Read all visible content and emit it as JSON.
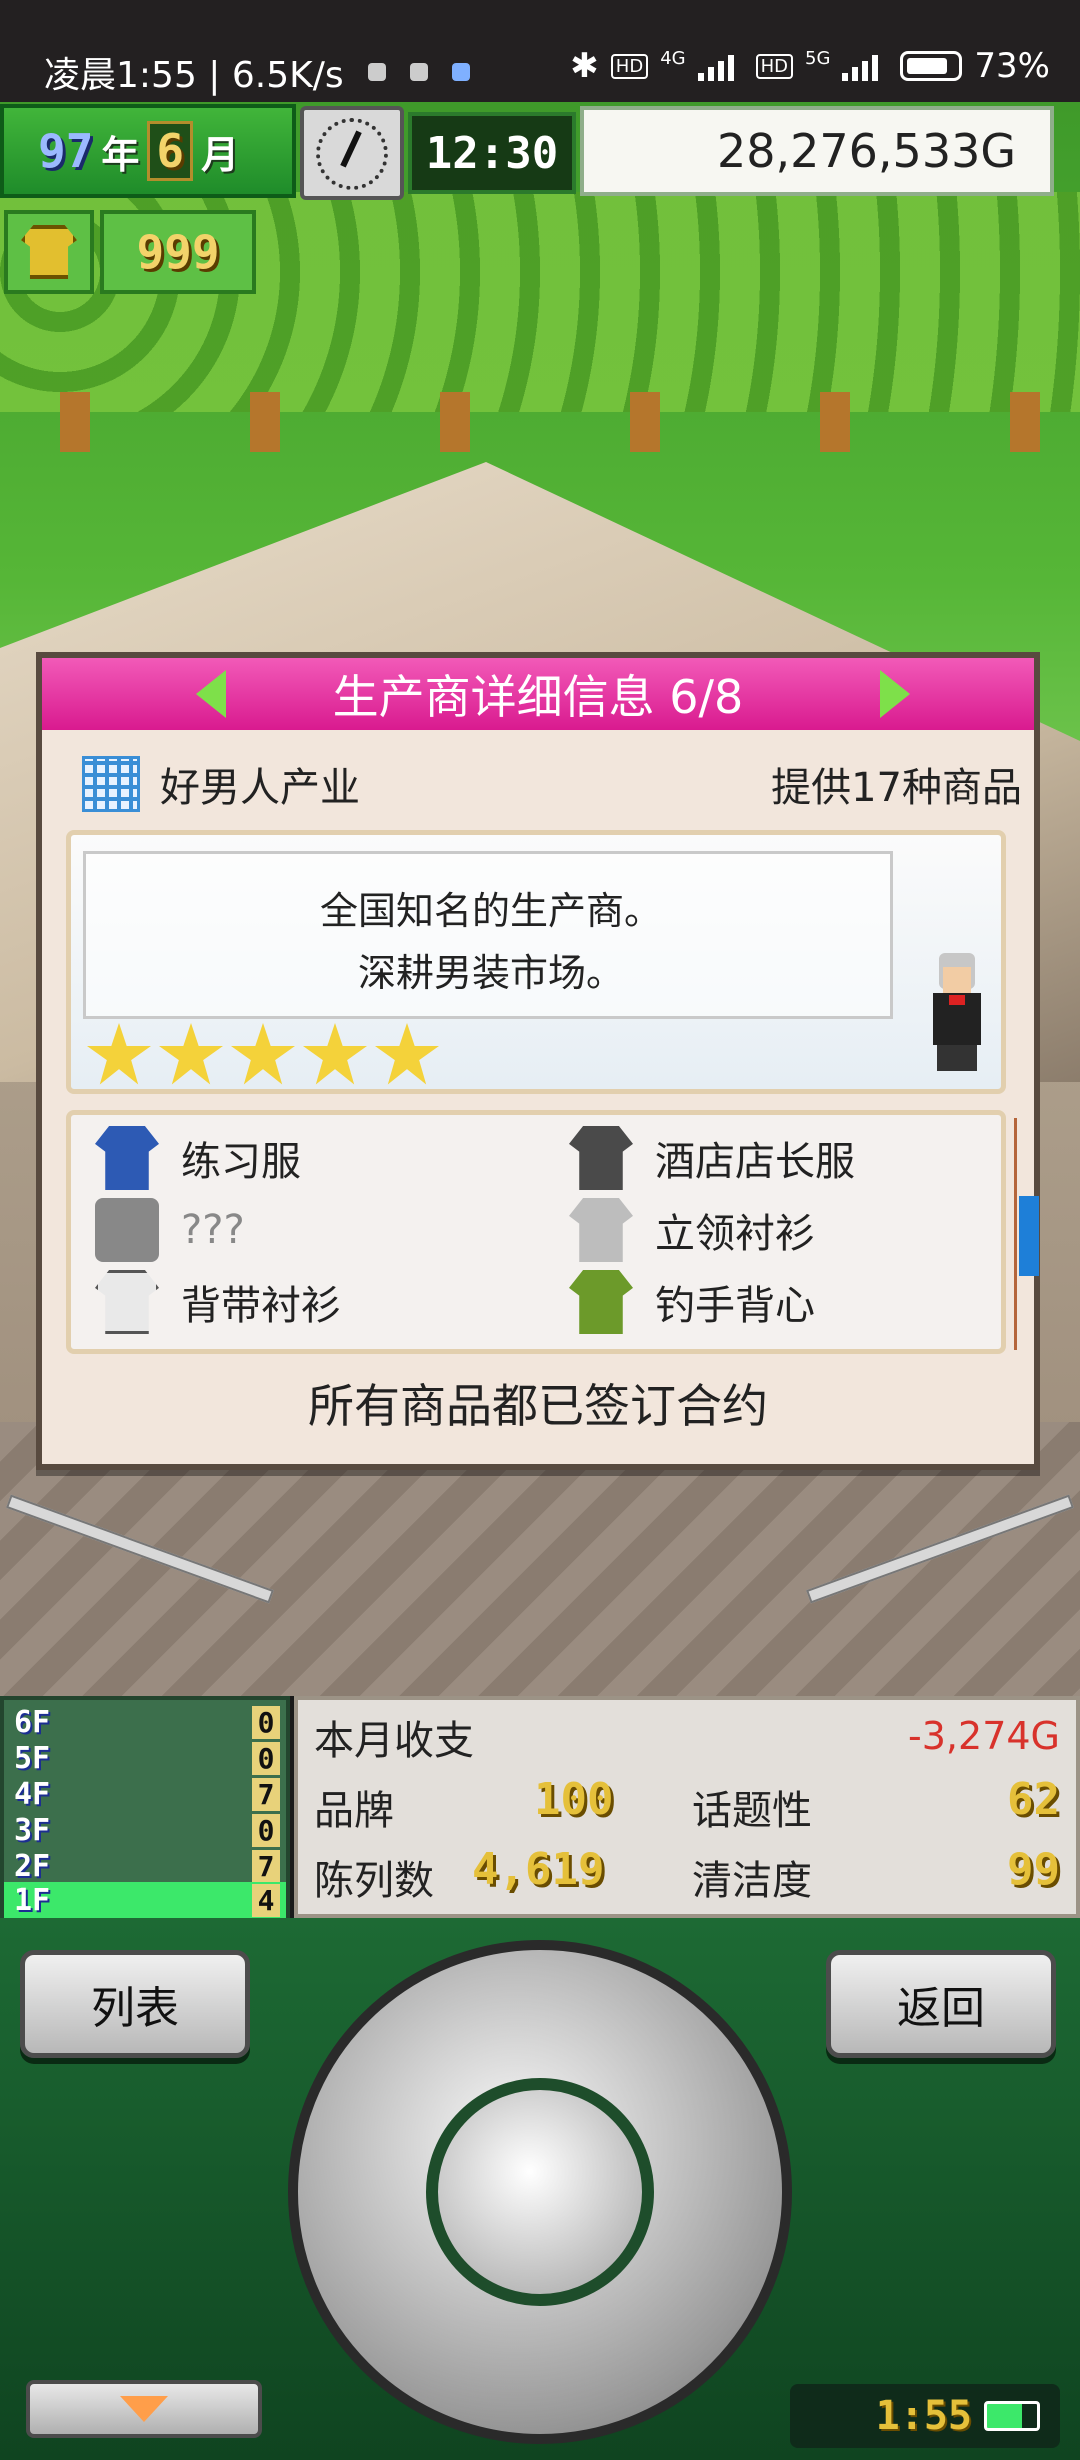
{
  "status_bar": {
    "time_speed": "凌晨1:55 | 6.5K/s",
    "network_1": "4G",
    "network_2": "5G",
    "battery": "73%"
  },
  "hud": {
    "year_num": "97",
    "year_label": "年",
    "month_num": "6",
    "month_label": "月",
    "game_time": "12:30",
    "money": "28,276,533G",
    "item_count": "999"
  },
  "dialog": {
    "title": "生产商详细信息 6/8",
    "maker_name": "好男人产业",
    "product_count": "提供17种商品",
    "description_line1": "全国知名的生产商。",
    "description_line2": "深耕男装市场。",
    "star_rating": 5,
    "items": [
      {
        "name": "练习服",
        "icon": "blue-jacket-icon"
      },
      {
        "name": "酒店店长服",
        "icon": "dark-suit-icon"
      },
      {
        "name": "???",
        "icon": "unknown-icon"
      },
      {
        "name": "立领衬衫",
        "icon": "silver-shirt-icon"
      },
      {
        "name": "背带衬衫",
        "icon": "suspender-shirt-icon"
      },
      {
        "name": "钓手背心",
        "icon": "fishing-vest-icon"
      }
    ],
    "footer": "所有商品都已签订合约"
  },
  "floors": [
    {
      "label": "6F",
      "count": "0"
    },
    {
      "label": "5F",
      "count": "0"
    },
    {
      "label": "4F",
      "count": "7"
    },
    {
      "label": "3F",
      "count": "0"
    },
    {
      "label": "2F",
      "count": "7"
    },
    {
      "label": "1F",
      "count": "4"
    }
  ],
  "stats": {
    "monthly_label": "本月收支",
    "monthly_value": "-3,274G",
    "brand_label": "品牌",
    "brand_value": "100",
    "topic_label": "话题性",
    "topic_value": "62",
    "display_label": "陈列数",
    "display_value": "4,619",
    "clean_label": "清洁度",
    "clean_value": "99"
  },
  "controller": {
    "list_label": "列表",
    "back_label": "返回",
    "clock": "1:55"
  }
}
